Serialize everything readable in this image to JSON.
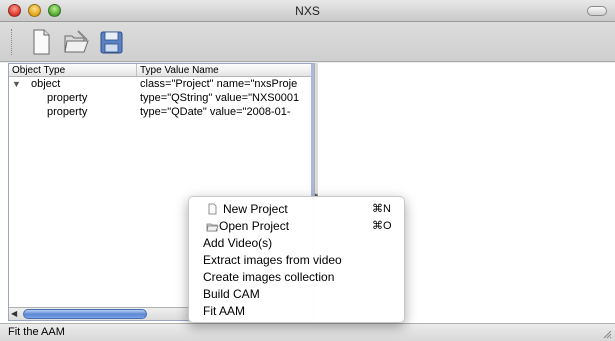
{
  "window": {
    "title": "NXS"
  },
  "tree": {
    "columns": [
      "Object Type",
      "Type Value Name"
    ],
    "rows": [
      {
        "type": "object",
        "value": "class=\"Project\" name=\"nxsProje"
      },
      {
        "type": "property",
        "value": "type=\"QString\" value=\"NXS0001"
      },
      {
        "type": "property",
        "value": "type=\"QDate\" value=\"2008-01-"
      }
    ]
  },
  "menu": {
    "items": [
      {
        "label": "New Project",
        "shortcut": "⌘N",
        "icon": "new-document-icon"
      },
      {
        "label": "Open Project",
        "shortcut": "⌘O",
        "icon": "open-folder-icon"
      },
      {
        "label": "Add Video(s)"
      },
      {
        "label": "Extract images from video"
      },
      {
        "label": "Create images collection"
      },
      {
        "label": "Build CAM"
      },
      {
        "label": "Fit AAM"
      }
    ]
  },
  "status": {
    "text": "Fit the AAM"
  },
  "toolbar": {
    "icons": [
      "new-document-icon",
      "open-folder-icon",
      "save-disk-icon"
    ]
  }
}
